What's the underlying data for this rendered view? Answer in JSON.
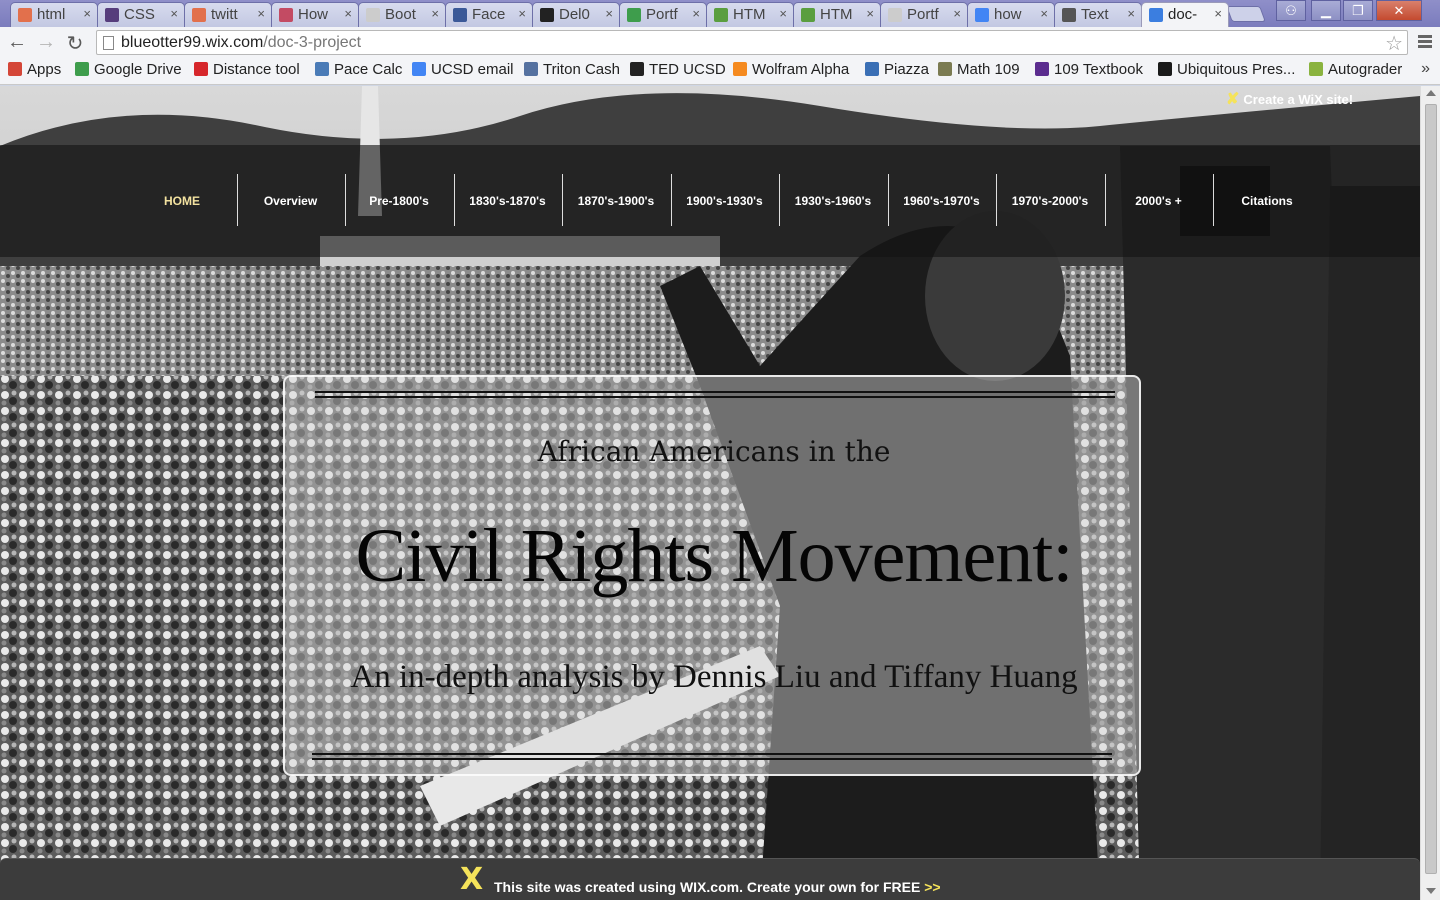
{
  "browser": {
    "tabs": [
      {
        "title": "html",
        "icon": "html-doc-icon",
        "icon_color": "#e2704c"
      },
      {
        "title": "CSS",
        "icon": "bootstrap-icon",
        "icon_color": "#563d7c"
      },
      {
        "title": "twitt",
        "icon": "html-doc-icon",
        "icon_color": "#e2704c"
      },
      {
        "title": "How",
        "icon": "stack-icon",
        "icon_color": "#c34b63"
      },
      {
        "title": "Boot",
        "icon": "page-icon",
        "icon_color": "#cccccc"
      },
      {
        "title": "Face",
        "icon": "facebook-icon",
        "icon_color": "#3b5998"
      },
      {
        "title": "Del0",
        "icon": "github-icon",
        "icon_color": "#222222"
      },
      {
        "title": "Portf",
        "icon": "drive-icon",
        "icon_color": "#3e9d4c"
      },
      {
        "title": "HTM",
        "icon": "w3schools-icon",
        "icon_color": "#5a9e3f"
      },
      {
        "title": "HTM",
        "icon": "w3schools-icon",
        "icon_color": "#5a9e3f"
      },
      {
        "title": "Portf",
        "icon": "page-icon",
        "icon_color": "#cccccc"
      },
      {
        "title": "how",
        "icon": "google-icon",
        "icon_color": "#4285f4"
      },
      {
        "title": "Text",
        "icon": "web-icon",
        "icon_color": "#555555"
      },
      {
        "title": "doc-",
        "icon": "wix-icon",
        "icon_color": "#3b7ee0",
        "active": true
      }
    ],
    "window_controls": {
      "minimize": "▁",
      "maximize": "❐",
      "close": "✕"
    },
    "nav": {
      "back": "←",
      "forward": "→",
      "reload": "↻"
    },
    "url": {
      "host": "blueotter99.wix.com",
      "path": "/doc-3-project"
    },
    "bookmarks": [
      {
        "label": "Apps",
        "icon": "apps-grid-icon",
        "color": "#d44638"
      },
      {
        "label": "Google Drive",
        "icon": "drive-icon",
        "color": "#3e9d4c"
      },
      {
        "label": "Distance tool",
        "icon": "distance-icon",
        "color": "#d6262b"
      },
      {
        "label": "Pace Calc",
        "icon": "pace-icon",
        "color": "#4a7bb7"
      },
      {
        "label": "UCSD email",
        "icon": "google-icon",
        "color": "#4285f4"
      },
      {
        "label": "Triton Cash",
        "icon": "triton-icon",
        "color": "#5571a0"
      },
      {
        "label": "TED UCSD",
        "icon": "ted-icon",
        "color": "#222222"
      },
      {
        "label": "Wolfram Alpha",
        "icon": "wolfram-icon",
        "color": "#f58a1f"
      },
      {
        "label": "Piazza",
        "icon": "piazza-icon",
        "color": "#3a6fb5"
      },
      {
        "label": "Math 109",
        "icon": "math-icon",
        "color": "#7b7b52"
      },
      {
        "label": "109 Textbook",
        "icon": "textbook-icon",
        "color": "#5b2c8f"
      },
      {
        "label": "Ubiquitous Pres...",
        "icon": "up-icon",
        "color": "#1a1a1a"
      },
      {
        "label": "Autograder",
        "icon": "autograder-icon",
        "color": "#8ab33f"
      }
    ],
    "bookmarks_more": "»"
  },
  "site": {
    "wix_top_link": "Create a WiX site!",
    "nav": [
      {
        "label": "HOME",
        "active": true
      },
      {
        "label": "Overview"
      },
      {
        "label": "Pre-1800's"
      },
      {
        "label": "1830's-1870's"
      },
      {
        "label": "1870's-1900's"
      },
      {
        "label": "1900's-1930's"
      },
      {
        "label": "1930's-1960's"
      },
      {
        "label": "1960's-1970's"
      },
      {
        "label": "1970's-2000's"
      },
      {
        "label": "2000's +"
      },
      {
        "label": "Citations"
      }
    ],
    "hero": {
      "subtitle": "African Americans in the",
      "title": "Civil Rights Movement:",
      "byline": "An in-depth analysis by Dennis Liu and Tiffany Huang"
    },
    "wix_banner": {
      "text": "This site was created using WIX.com. Create your own for FREE",
      "arrows": ">>"
    }
  },
  "colors": {
    "nav_active": "#f3e2a0",
    "wix_yellow": "#f5e35a"
  }
}
